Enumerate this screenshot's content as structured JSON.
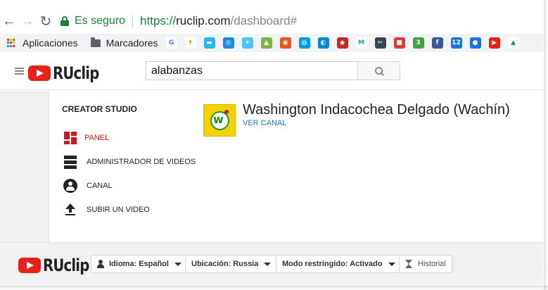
{
  "browser": {
    "secure_label": "Es seguro",
    "url_scheme": "https://",
    "url_host": "ruclip.com",
    "url_path": "/dashboard#",
    "bookmarks": {
      "apps_label": "Aplicaciones",
      "folder_label": "Marcadores",
      "favicons": [
        {
          "name": "google-icon",
          "glyph": "G",
          "bg": "#ffffff",
          "fg": "#4285f4"
        },
        {
          "name": "figure-icon",
          "glyph": "✝",
          "bg": "#ffffff",
          "fg": "#b8860b"
        },
        {
          "name": "chat-icon",
          "glyph": "▬",
          "bg": "#29b6f6",
          "fg": "#ffffff"
        },
        {
          "name": "globe-icon",
          "glyph": "◎",
          "bg": "#1e88e5",
          "fg": "#ffffff"
        },
        {
          "name": "satellite-icon",
          "glyph": "✦",
          "bg": "#4fc3f7",
          "fg": "#ffffff"
        },
        {
          "name": "android-icon",
          "glyph": "▲",
          "bg": "#7cb342",
          "fg": "#ffffff"
        },
        {
          "name": "ubuntu-icon",
          "glyph": "◉",
          "bg": "#e95420",
          "fg": "#ffffff"
        },
        {
          "name": "circle-blue-icon",
          "glyph": "◍",
          "bg": "#039be5",
          "fg": "#ffffff"
        },
        {
          "name": "swirl-icon",
          "glyph": "◐",
          "bg": "#0288d1",
          "fg": "#ffffff"
        },
        {
          "name": "red-shape-icon",
          "glyph": "◆",
          "bg": "#c62828",
          "fg": "#ffffff"
        },
        {
          "name": "m-icon",
          "glyph": "M",
          "bg": "#ffffff",
          "fg": "#26a69a"
        },
        {
          "name": "scissors-icon",
          "glyph": "✂",
          "bg": "#37474f",
          "fg": "#ffffff"
        },
        {
          "name": "bookmark-red-icon",
          "glyph": "■",
          "bg": "#e53935",
          "fg": "#ffffff"
        },
        {
          "name": "number-3-icon",
          "glyph": "3",
          "bg": "#43a047",
          "fg": "#ffffff"
        },
        {
          "name": "facebook-icon",
          "glyph": "f",
          "bg": "#3b5998",
          "fg": "#ffffff"
        },
        {
          "name": "calendar-icon",
          "glyph": "12",
          "bg": "#1976d2",
          "fg": "#ffffff"
        },
        {
          "name": "contacts-icon",
          "glyph": "●",
          "bg": "#1a73e8",
          "fg": "#ffffff"
        },
        {
          "name": "youtube-icon",
          "glyph": "▶",
          "bg": "#e62117",
          "fg": "#ffffff"
        },
        {
          "name": "drive-icon",
          "glyph": "▲",
          "bg": "#ffffff",
          "fg": "#0f9d58"
        }
      ]
    }
  },
  "header": {
    "logo_text": "RUclip",
    "search_value": "alabanzas"
  },
  "sidebar": {
    "title": "CREATOR STUDIO",
    "items": [
      {
        "label": "PANEL",
        "active": true
      },
      {
        "label": "ADMINISTRADOR DE VIDEOS",
        "active": false
      },
      {
        "label": "CANAL",
        "active": false
      },
      {
        "label": "SUBIR UN VIDEO",
        "active": false
      }
    ]
  },
  "channel": {
    "name": "Washington Indacochea Delgado (Wachín)",
    "link_label": "VER CANAL",
    "thumb_letter": "w"
  },
  "footer": {
    "logo_text": "RUclip",
    "language_label": "Idioma: Español",
    "location_label": "Ubicación: Russia",
    "restricted_label": "Modo restringido: Activado",
    "history_label": "Historial"
  },
  "colors": {
    "accent_red": "#cc181e",
    "link_blue": "#167ac6",
    "secure_green": "#188038"
  }
}
